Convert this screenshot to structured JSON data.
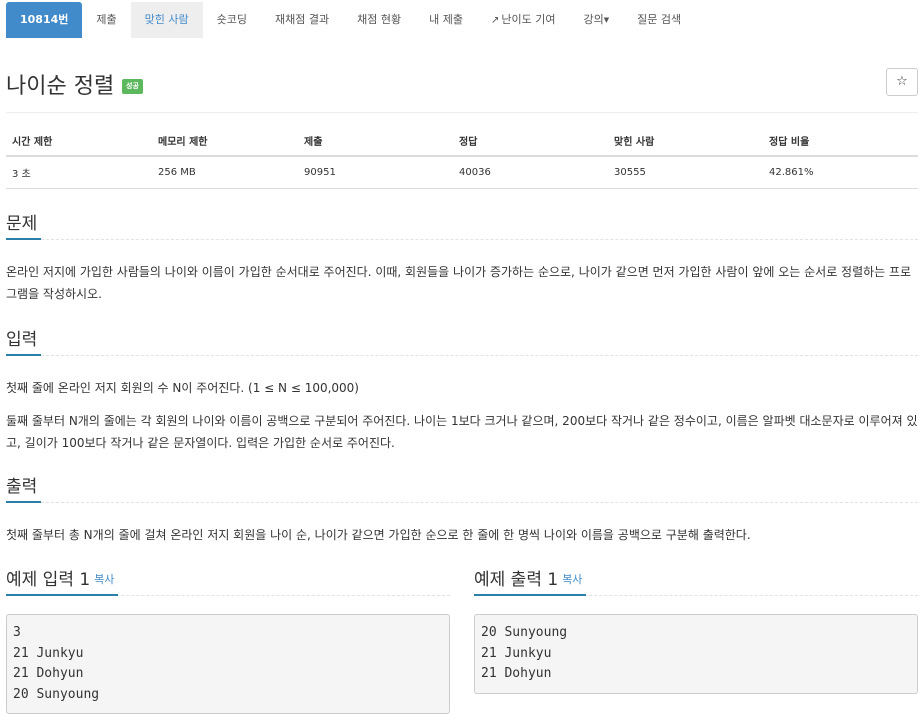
{
  "nav": {
    "problem_no": "10814번",
    "submit": "제출",
    "solvers": "맞힌 사람",
    "shortest": "숏코딩",
    "rejudge": "재채점 결과",
    "status": "채점 현황",
    "my_submit": "내 제출",
    "difficulty": "난이도 기여",
    "lecture": "강의",
    "qna": "질문 검색"
  },
  "problem": {
    "title": "나이순 정렬",
    "badge": "성공"
  },
  "info_table": {
    "headers": [
      "시간 제한",
      "메모리 제한",
      "제출",
      "정답",
      "맞힌 사람",
      "정답 비율"
    ],
    "values": [
      "3 초",
      "256 MB",
      "90951",
      "40036",
      "30555",
      "42.861%"
    ]
  },
  "sections": {
    "description": {
      "heading": "문제",
      "text": "온라인 저지에 가입한 사람들의 나이와 이름이 가입한 순서대로 주어진다. 이때, 회원들을 나이가 증가하는 순으로, 나이가 같으면 먼저 가입한 사람이 앞에 오는 순서로 정렬하는 프로그램을 작성하시오."
    },
    "input": {
      "heading": "입력",
      "line1": "첫째 줄에 온라인 저지 회원의 수 N이 주어진다. (1 ≤ N ≤ 100,000)",
      "line2": "둘째 줄부터 N개의 줄에는 각 회원의 나이와 이름이 공백으로 구분되어 주어진다. 나이는 1보다 크거나 같으며, 200보다 작거나 같은 정수이고, 이름은 알파벳 대소문자로 이루어져 있고, 길이가 100보다 작거나 같은 문자열이다. 입력은 가입한 순서로 주어진다."
    },
    "output": {
      "heading": "출력",
      "text": "첫째 줄부터 총 N개의 줄에 걸쳐 온라인 저지 회원을 나이 순, 나이가 같으면 가입한 순으로 한 줄에 한 명씩 나이와 이름을 공백으로 구분해 출력한다."
    }
  },
  "samples": {
    "input": {
      "heading": "예제 입력 1",
      "copy": "복사",
      "content": "3\n21 Junkyu\n21 Dohyun\n20 Sunyoung"
    },
    "output": {
      "heading": "예제 출력 1",
      "copy": "복사",
      "content": "20 Sunyoung\n21 Junkyu\n21 Dohyun"
    }
  },
  "icons": {
    "star": "star-icon",
    "external_link": "external-link-icon",
    "caret": "caret-down-icon"
  },
  "colors": {
    "accent": "#428bca",
    "success": "#5cb85c",
    "heading_underline": "#2c7fa8"
  }
}
